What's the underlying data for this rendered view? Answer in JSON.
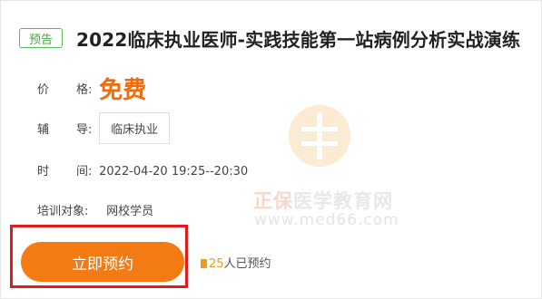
{
  "card": {
    "tag": "预告",
    "title": "2022临床执业医师-实践技能第一站病例分析实战演练",
    "price_label_1": "价",
    "price_label_2": "格:",
    "price": "免费",
    "tutor_label_1": "辅",
    "tutor_label_2": "导:",
    "tutor": "临床执业",
    "time_label_1": "时",
    "time_label_2": "间:",
    "time": "2022-04-20 19:25--20:30",
    "target_label": "培训对象:",
    "target": "网校学员",
    "cta_label": "立即预约",
    "booked_count_partial": "25",
    "booked_suffix": "人已预约"
  },
  "watermark": {
    "brand_a": "正保",
    "brand_b": "医学教育网",
    "url": "www.med66.com"
  },
  "colors": {
    "accent": "#f47a14",
    "price": "#f26a0a",
    "tag_green": "#45a845",
    "highlight_red": "#e31b1b"
  }
}
